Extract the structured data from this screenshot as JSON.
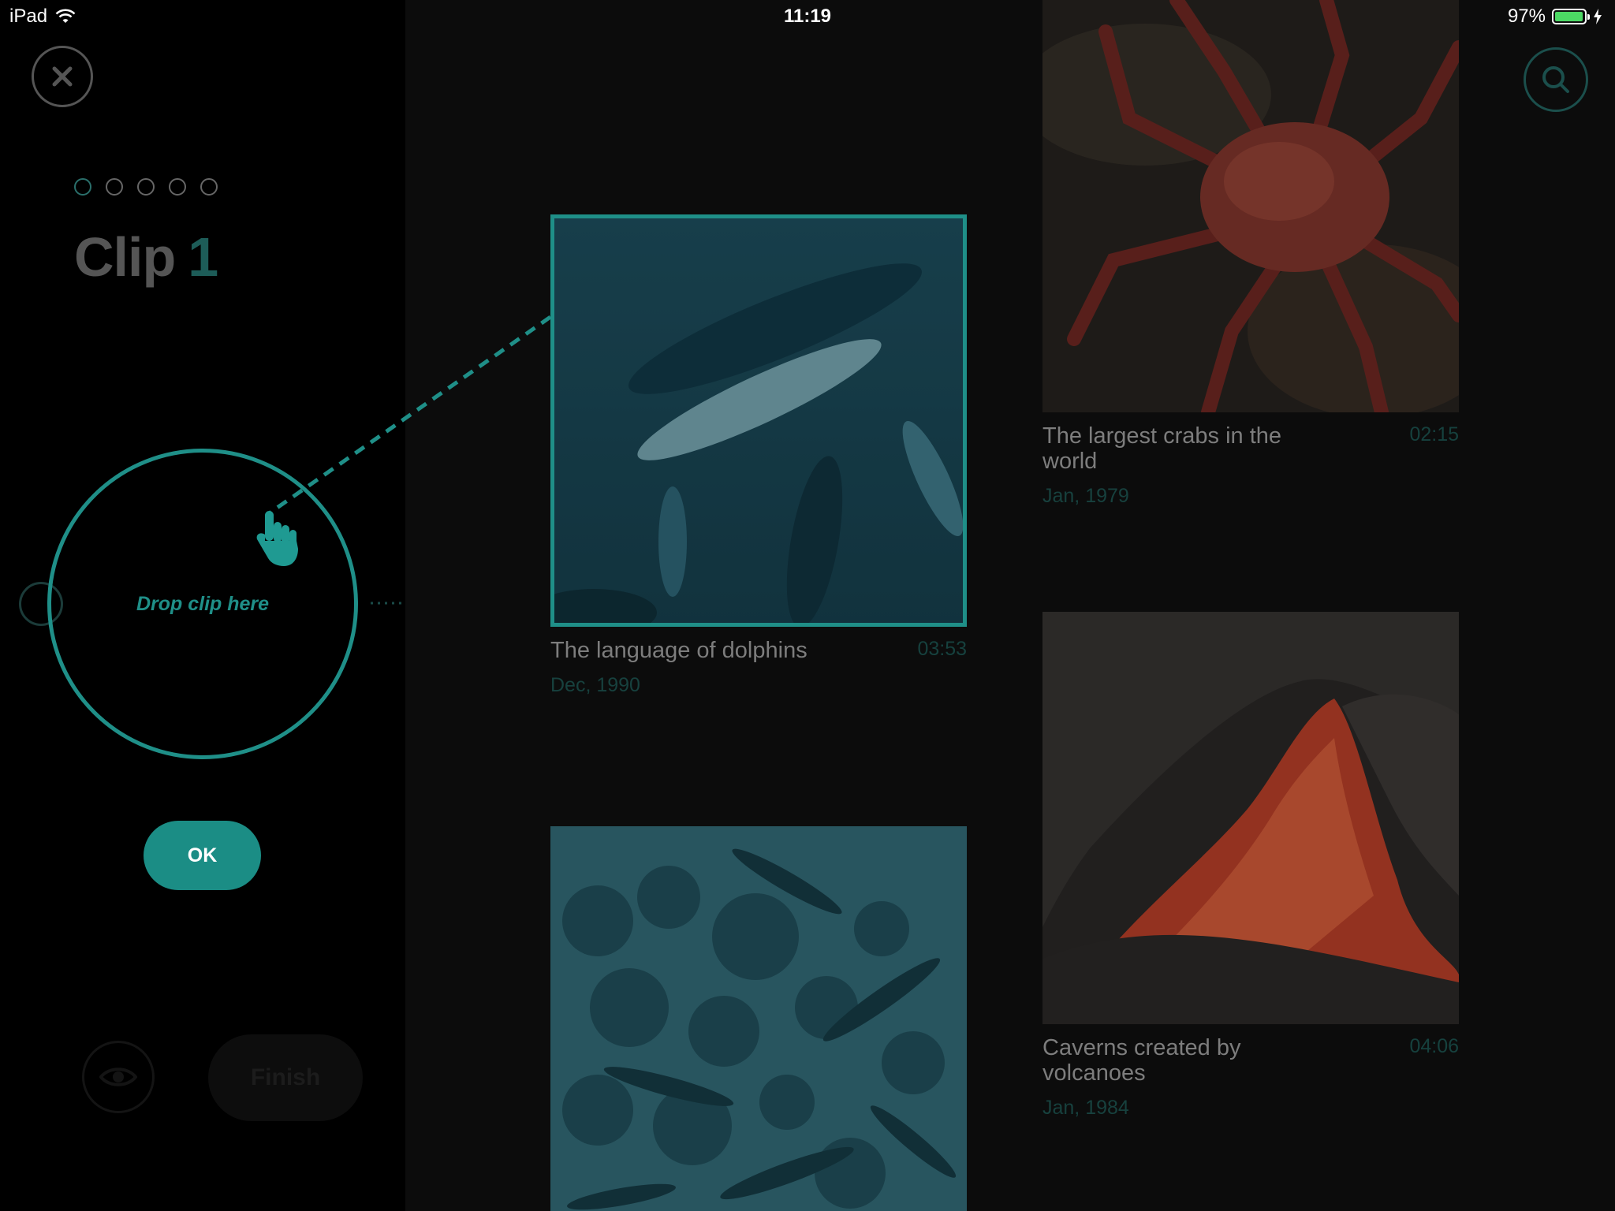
{
  "status_bar": {
    "device": "iPad",
    "time": "11:19",
    "battery": "97%",
    "battery_level": 0.97
  },
  "sidebar": {
    "step_count": 5,
    "active_step": 1,
    "title_word": "Clip",
    "title_number": "1",
    "drop_label": "Drop clip here",
    "ok_label": "OK",
    "finish_label": "Finish"
  },
  "clips": [
    {
      "title": "The largest crabs in the world",
      "duration": "02:15",
      "date": "Jan, 1979"
    },
    {
      "title": "The language of dolphins",
      "duration": "03:53",
      "date": "Dec, 1990"
    },
    {
      "title": "Caverns created by volcanoes",
      "duration": "04:06",
      "date": "Jan, 1984"
    },
    {
      "title": "",
      "duration": "",
      "date": ""
    }
  ],
  "colors": {
    "accent": "#1f8f88",
    "panel": "#000000",
    "background": "#0c0c0c"
  }
}
